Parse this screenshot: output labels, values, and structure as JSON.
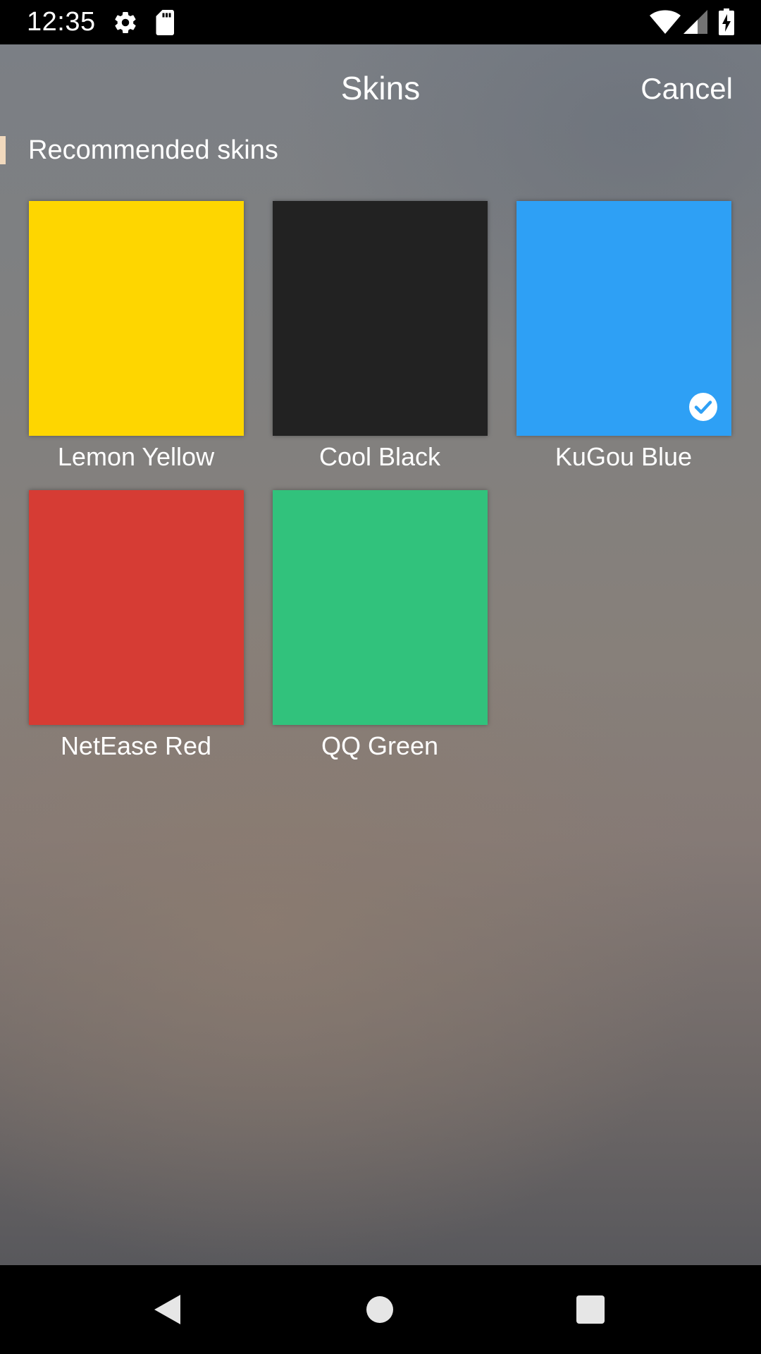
{
  "status_bar": {
    "time": "12:35",
    "icons": [
      "gear-icon",
      "sd-card-icon",
      "wifi-icon",
      "cell-signal-icon",
      "battery-charging-icon"
    ]
  },
  "header": {
    "title": "Skins",
    "cancel_label": "Cancel"
  },
  "section": {
    "title": "Recommended skins",
    "marker_color": "#f1d9bd"
  },
  "skins": [
    {
      "label": "Lemon Yellow",
      "color": "#fed600",
      "selected": false
    },
    {
      "label": "Cool Black",
      "color": "#222222",
      "selected": false
    },
    {
      "label": "KuGou Blue",
      "color": "#2ea0f5",
      "selected": true
    },
    {
      "label": "NetEase Red",
      "color": "#d63c34",
      "selected": false
    },
    {
      "label": "QQ Green",
      "color": "#31c27c",
      "selected": false
    }
  ],
  "nav_bar": {
    "buttons": [
      "back-icon",
      "home-icon",
      "recents-icon"
    ]
  }
}
